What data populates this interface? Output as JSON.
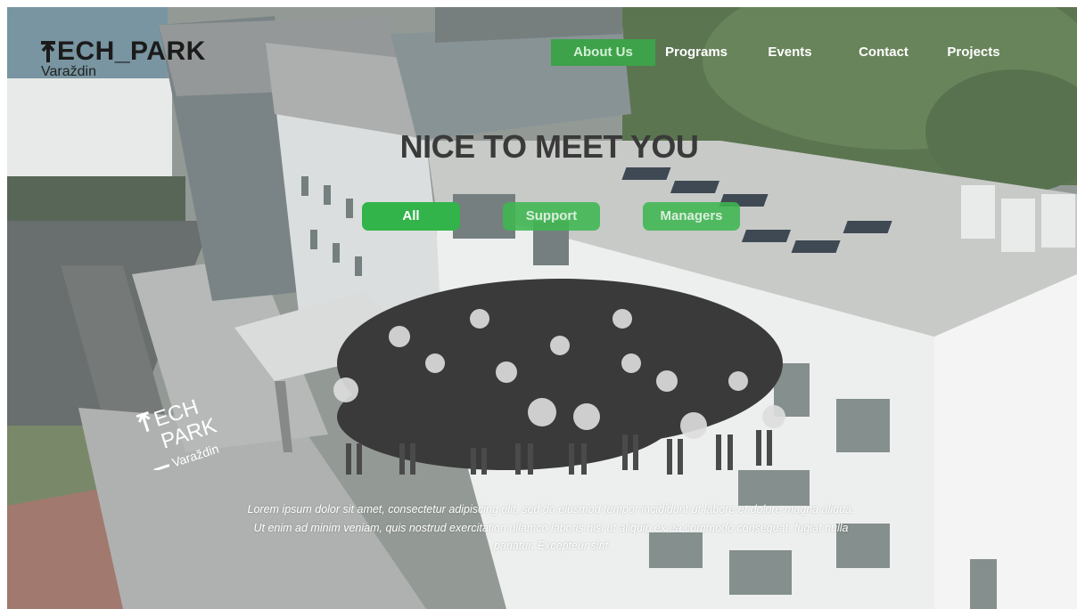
{
  "brand": {
    "title": "ECH_PARK",
    "subtitle": "Varaždin"
  },
  "nav": {
    "items": [
      {
        "label": "About Us",
        "active": true
      },
      {
        "label": "Programs",
        "active": false
      },
      {
        "label": "Events",
        "active": false
      },
      {
        "label": "Contact",
        "active": false
      },
      {
        "label": "Projects",
        "active": false
      }
    ]
  },
  "hero": {
    "headline": "NICE TO MEET YOU",
    "filters": [
      "All",
      "Support",
      "Managers"
    ],
    "paragraph": "Lorem ipsum dolor sit amet, consectetur adipiscing elit, sed do eiusmod tempor incididunt ut labore et dolore magna aliqua. Ut enim ad minim veniam, quis nostrud exercitation ullamco laboris nisi ut aliquip ex ea commodo consequat. fugiat nulla pariatur. Excepteur sint"
  },
  "wall_sign": {
    "line1": "ECH",
    "line2": "PARK",
    "line3": "Varaždin"
  },
  "colors": {
    "accent_green": "#32b44a",
    "nav_active": "#3da24a",
    "headline": "#3a3a3a"
  }
}
